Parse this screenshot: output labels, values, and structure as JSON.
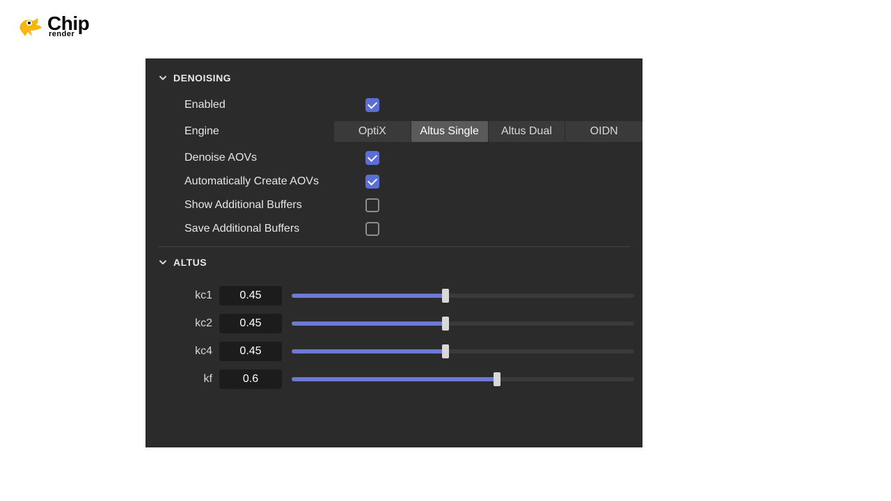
{
  "logo": {
    "main": "Chip",
    "sub": "render"
  },
  "denoising": {
    "title": "DENOISING",
    "enabled_label": "Enabled",
    "enabled_checked": true,
    "engine_label": "Engine",
    "engine_options": [
      "OptiX",
      "Altus Single",
      "Altus Dual",
      "OIDN"
    ],
    "engine_selected": "Altus Single",
    "denoise_aovs_label": "Denoise AOVs",
    "denoise_aovs_checked": true,
    "auto_create_aovs_label": "Automatically Create AOVs",
    "auto_create_aovs_checked": true,
    "show_buffers_label": "Show Additional Buffers",
    "show_buffers_checked": false,
    "save_buffers_label": "Save Additional Buffers",
    "save_buffers_checked": false
  },
  "altus": {
    "title": "ALTUS",
    "sliders": [
      {
        "name": "kc1",
        "value": "0.45",
        "percent": 45
      },
      {
        "name": "kc2",
        "value": "0.45",
        "percent": 45
      },
      {
        "name": "kc4",
        "value": "0.45",
        "percent": 45
      },
      {
        "name": "kf",
        "value": "0.6",
        "percent": 60
      }
    ]
  }
}
